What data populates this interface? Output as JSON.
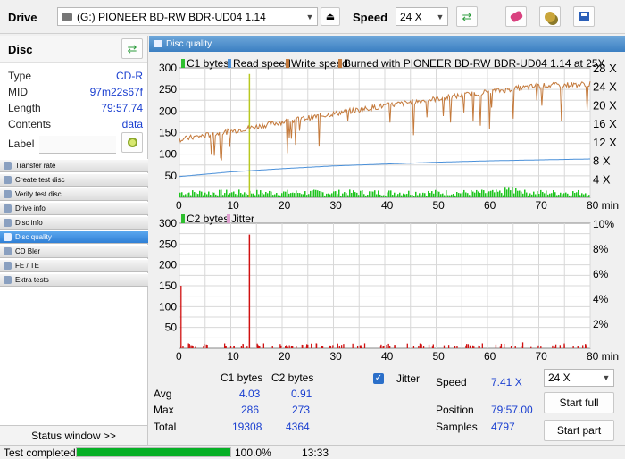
{
  "toolbar": {
    "drive_label": "Drive",
    "drive_value": "(G:)  PIONEER BD-RW   BDR-UD04 1.14",
    "speed_label": "Speed",
    "speed_value": "24 X"
  },
  "disc": {
    "title": "Disc",
    "rows": [
      {
        "key": "Type",
        "value": "CD-R"
      },
      {
        "key": "MID",
        "value": "97m22s67f"
      },
      {
        "key": "Length",
        "value": "79:57.74"
      },
      {
        "key": "Contents",
        "value": "data"
      }
    ],
    "label_key": "Label",
    "label_value": ""
  },
  "nav": {
    "items": [
      "Transfer rate",
      "Create test disc",
      "Verify test disc",
      "Drive info",
      "Disc info",
      "Disc quality",
      "CD Bler",
      "FE / TE",
      "Extra tests"
    ],
    "active_index": 5
  },
  "status_window_label": "Status window >>",
  "statusbar": {
    "text": "Test completed",
    "progress": 100,
    "progress_text": "100.0%",
    "time": "13:33"
  },
  "panel": {
    "title": "Disc quality"
  },
  "chart_data": [
    {
      "type": "area",
      "legend": [
        "C1 bytes",
        "Read speed",
        "Write speed",
        "Burned with PIONEER BD-RW   BDR-UD04 1.14 at 25X"
      ],
      "x_ticks": [
        "0",
        "10",
        "20",
        "30",
        "40",
        "50",
        "60",
        "70",
        "80 min"
      ],
      "y_ticks_left": [
        "300",
        "250",
        "200",
        "150",
        "100",
        "50"
      ],
      "y_ticks_right": [
        "28 X",
        "24 X",
        "20 X",
        "16 X",
        "12 X",
        "8 X",
        "4 X"
      ],
      "xlim": [
        0,
        80
      ],
      "ylim_left": [
        0,
        300
      ],
      "ylim_right": [
        0,
        28
      ],
      "series": [
        {
          "name": "C1 bytes",
          "peak_x": 13.5,
          "peak_y": 286
        },
        {
          "name": "Read speed",
          "x": [
            0,
            10,
            20,
            30,
            40,
            50,
            60,
            70,
            80
          ],
          "y": [
            4.5,
            5.5,
            6.2,
            6.8,
            7.2,
            7.6,
            7.9,
            8.1,
            8.3
          ]
        },
        {
          "name": "Write speed",
          "x": [
            0,
            10,
            20,
            30,
            40,
            50,
            60,
            70,
            80
          ],
          "y": [
            12.5,
            14.3,
            16.3,
            18.1,
            19.8,
            21.3,
            22.8,
            24.1,
            24.5
          ]
        }
      ]
    },
    {
      "type": "bar",
      "legend": [
        "C2 bytes",
        "Jitter"
      ],
      "x_ticks": [
        "0",
        "10",
        "20",
        "30",
        "40",
        "50",
        "60",
        "70",
        "80 min"
      ],
      "y_ticks_left": [
        "300",
        "250",
        "200",
        "150",
        "100",
        "50"
      ],
      "y_ticks_right": [
        "10%",
        "8%",
        "6%",
        "4%",
        "2%"
      ],
      "xlim": [
        0,
        80
      ],
      "ylim_left": [
        0,
        300
      ],
      "series": [
        {
          "name": "C2 bytes",
          "peak_x": 13.5,
          "peak_y": 273
        }
      ]
    }
  ],
  "stats": {
    "col_c1": "C1 bytes",
    "col_c2": "C2 bytes",
    "rows": [
      {
        "label": "Avg",
        "c1": "4.03",
        "c2": "0.91"
      },
      {
        "label": "Max",
        "c1": "286",
        "c2": "273"
      },
      {
        "label": "Total",
        "c1": "19308",
        "c2": "4364"
      }
    ],
    "jitter_label": "Jitter",
    "speed_label": "Speed",
    "speed_value": "7.41 X",
    "position_label": "Position",
    "position_value": "79:57.00",
    "samples_label": "Samples",
    "samples_value": "4797",
    "speed_combo": "24 X",
    "start_full": "Start full",
    "start_part": "Start part"
  }
}
